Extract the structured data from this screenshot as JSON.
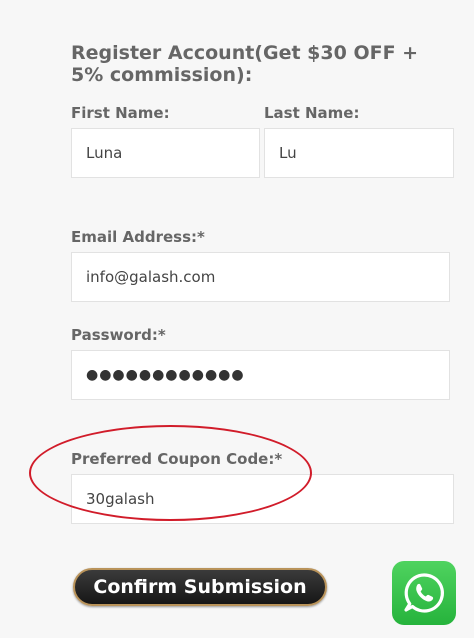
{
  "form": {
    "title": "Register Account(Get $30 OFF + 5% commission):",
    "first_name_label": "First Name:",
    "first_name_value": "Luna",
    "last_name_label": "Last Name:",
    "last_name_value": "Lu",
    "email_label": "Email Address:*",
    "email_value": "info@galash.com",
    "password_label": "Password:*",
    "password_value": "●●●●●●●●●●●●",
    "coupon_label": "Preferred Coupon Code:*",
    "coupon_value": "30galash",
    "submit_label": "Confirm Submission"
  },
  "icons": {
    "whatsapp": "whatsapp-icon"
  },
  "colors": {
    "highlight": "#d11c2a",
    "whatsapp": "#2bb741",
    "button_border": "#b9935a"
  }
}
